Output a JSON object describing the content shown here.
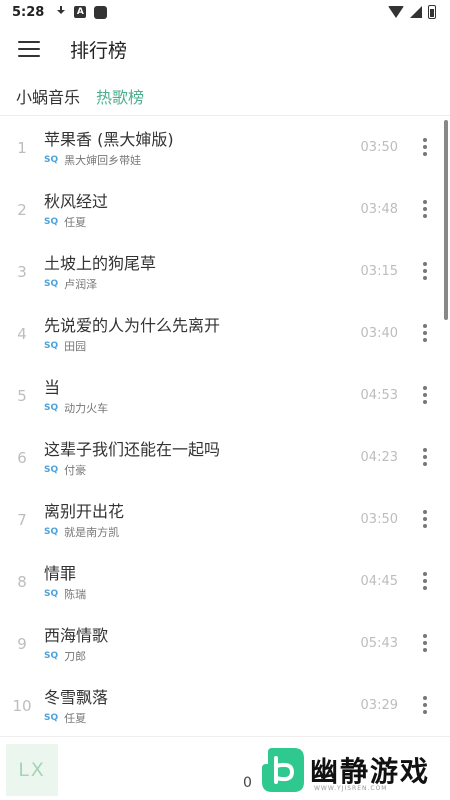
{
  "status_bar": {
    "time": "5:28",
    "icons": [
      "download-icon",
      "app-a-icon",
      "app-square-icon",
      "wifi-icon",
      "signal-icon",
      "battery-icon"
    ]
  },
  "toolbar": {
    "title": "排行榜"
  },
  "tabs": [
    {
      "label": "小蜗音乐",
      "active": false
    },
    {
      "label": "热歌榜",
      "active": true
    }
  ],
  "accent_color": "#4caf8f",
  "songs": [
    {
      "rank": "1",
      "title": "苹果香 (黑大婶版)",
      "quality": "SQ",
      "artist": "黑大婶回乡带娃",
      "duration": "03:50"
    },
    {
      "rank": "2",
      "title": "秋风经过",
      "quality": "SQ",
      "artist": "任夏",
      "duration": "03:48"
    },
    {
      "rank": "3",
      "title": "土坡上的狗尾草",
      "quality": "SQ",
      "artist": "卢润泽",
      "duration": "03:15"
    },
    {
      "rank": "4",
      "title": "先说爱的人为什么先离开",
      "quality": "SQ",
      "artist": "田园",
      "duration": "03:40"
    },
    {
      "rank": "5",
      "title": "当",
      "quality": "SQ",
      "artist": "动力火车",
      "duration": "04:53"
    },
    {
      "rank": "6",
      "title": "这辈子我们还能在一起吗",
      "quality": "SQ",
      "artist": "付豪",
      "duration": "04:23"
    },
    {
      "rank": "7",
      "title": "离别开出花",
      "quality": "SQ",
      "artist": "就是南方凯",
      "duration": "03:50"
    },
    {
      "rank": "8",
      "title": "情罪",
      "quality": "SQ",
      "artist": "陈瑞",
      "duration": "04:45"
    },
    {
      "rank": "9",
      "title": "西海情歌",
      "quality": "SQ",
      "artist": "刀郎",
      "duration": "05:43"
    },
    {
      "rank": "10",
      "title": "冬雪飘落",
      "quality": "SQ",
      "artist": "任夏",
      "duration": "03:29"
    }
  ],
  "player": {
    "logo_text": "LX",
    "progress": "0"
  },
  "watermark": {
    "name": "幽静游戏",
    "url": "WWW.YJISREN.COM"
  }
}
